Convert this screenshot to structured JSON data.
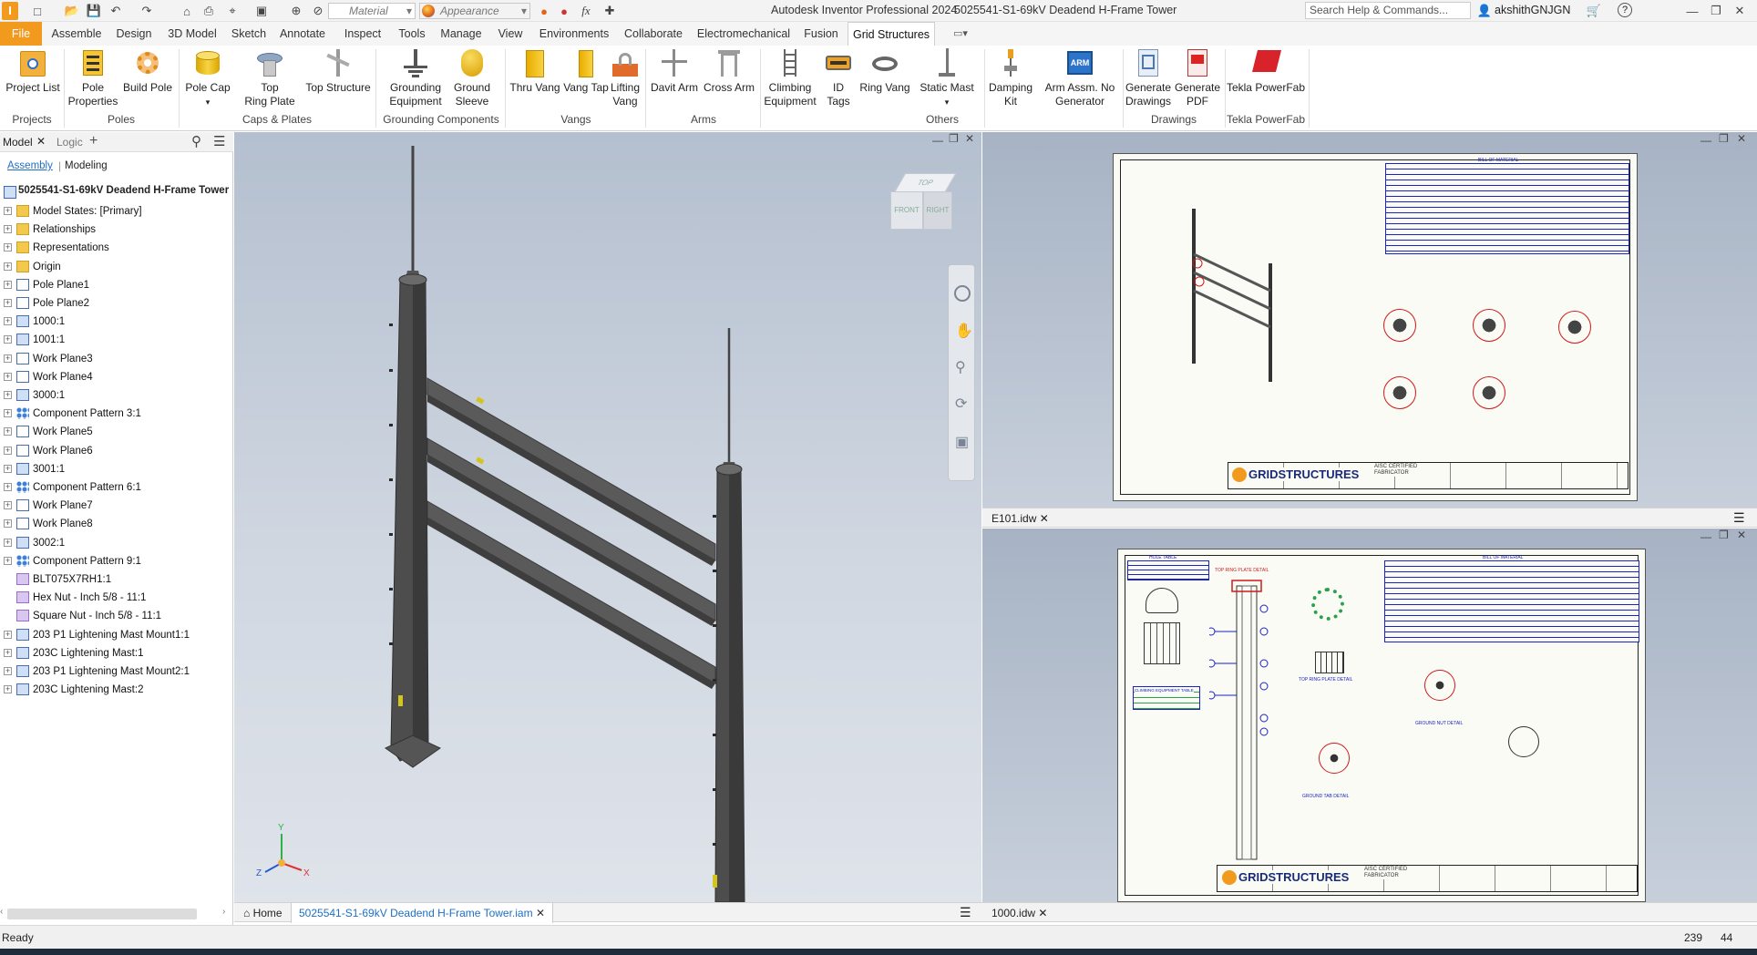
{
  "title_bar": {
    "material_placeholder": "Material",
    "appearance_placeholder": "Appearance",
    "app_title": "Autodesk Inventor Professional 2024",
    "doc_title": "5025541-S1-69kV Deadend H-Frame Tower",
    "search_placeholder": "Search Help & Commands...",
    "user": "akshithGNJGN",
    "help": "?"
  },
  "ribbon_tabs": [
    "File",
    "Assemble",
    "Design",
    "3D Model",
    "Sketch",
    "Annotate",
    "Inspect",
    "Tools",
    "Manage",
    "View",
    "Environments",
    "Collaborate",
    "Electromechanical",
    "Fusion",
    "Grid Structures"
  ],
  "ribbon": {
    "buttons": [
      {
        "label1": "Project List",
        "label2": ""
      },
      {
        "label1": "Pole",
        "label2": "Properties"
      },
      {
        "label1": "Build Pole",
        "label2": ""
      },
      {
        "label1": "Pole Cap",
        "label2": ""
      },
      {
        "label1": "Top",
        "label2": "Ring Plate"
      },
      {
        "label1": "Top Structure",
        "label2": ""
      },
      {
        "label1": "Grounding",
        "label2": "Equipment"
      },
      {
        "label1": "Ground",
        "label2": "Sleeve"
      },
      {
        "label1": "Thru Vang",
        "label2": ""
      },
      {
        "label1": "Vang Tap",
        "label2": ""
      },
      {
        "label1": "Lifting",
        "label2": "Vang"
      },
      {
        "label1": "Davit Arm",
        "label2": ""
      },
      {
        "label1": "Cross Arm",
        "label2": ""
      },
      {
        "label1": "Climbing",
        "label2": "Equipment"
      },
      {
        "label1": "ID Tags",
        "label2": ""
      },
      {
        "label1": "Ring Vang",
        "label2": ""
      },
      {
        "label1": "Static Mast",
        "label2": ""
      },
      {
        "label1": "Damping",
        "label2": "Kit"
      },
      {
        "label1": "Arm Assm. No",
        "label2": "Generator"
      },
      {
        "label1": "Generate",
        "label2": "Drawings"
      },
      {
        "label1": "Generate",
        "label2": "PDF"
      },
      {
        "label1": "Tekla PowerFab",
        "label2": ""
      }
    ],
    "panels": [
      "Projects",
      "Poles",
      "Caps & Plates",
      "Grounding Components",
      "Vangs",
      "Arms",
      "Others",
      "Drawings",
      "Tekla PowerFab"
    ]
  },
  "browser": {
    "tabs": [
      "Model",
      "Logic"
    ],
    "modes": [
      "Assembly",
      "Modeling"
    ],
    "root": "5025541-S1-69kV Deadend H-Frame Tower",
    "items": [
      "Model States: [Primary]",
      "Relationships",
      "Representations",
      "Origin",
      "Pole Plane1",
      "Pole Plane2",
      "1000:1",
      "1001:1",
      "Work Plane3",
      "Work Plane4",
      "3000:1",
      "Component Pattern 3:1",
      "Work Plane5",
      "Work Plane6",
      "3001:1",
      "Component Pattern 6:1",
      "Work Plane7",
      "Work Plane8",
      "3002:1",
      "Component Pattern 9:1",
      "BLT075X7RH1:1",
      "Hex Nut - Inch 5/8 - 11:1",
      "Square Nut - Inch 5/8 - 11:1",
      "203 P1 Lightening Mast Mount1:1",
      "203C Lightening Mast:1",
      "203 P1 Lightening Mast Mount2:1",
      "203C Lightening Mast:2"
    ]
  },
  "viewcube": {
    "top": "TOP",
    "front": "FRONT",
    "right": "RIGHT"
  },
  "triad": {
    "x": "X",
    "y": "Y",
    "z": "Z"
  },
  "drawings": {
    "upper_tab": "E101.idw",
    "lower_tab": "1000.idw",
    "brand": "GRIDSTRUCTURES",
    "brand_sub": "AISC CERTIFIED FABRICATOR",
    "bom_title": "BILL OF MATERIAL",
    "hole_table": "HOLE TABLE",
    "top_ring_detail": "TOP RING PLATE DETAIL",
    "ground_nut_detail": "GROUND NUT DETAIL",
    "ground_tab_detail": "GROUND TAB DETAIL",
    "climbing_table": "CLIMBING EQUIPMENT TABLE",
    "top_plate_label": "TOP RING PLATE DETAIL"
  },
  "bottom_tabs": {
    "home": "Home",
    "active": "5025541-S1-69kV Deadend H-Frame Tower.iam"
  },
  "status": {
    "text": "Ready",
    "n1": "239",
    "n2": "44"
  },
  "colors": {
    "accent": "#f29a1e",
    "steel": "#4a4a4a",
    "drawing_blue": "#1a22c8",
    "drawing_red": "#d01a1a"
  }
}
